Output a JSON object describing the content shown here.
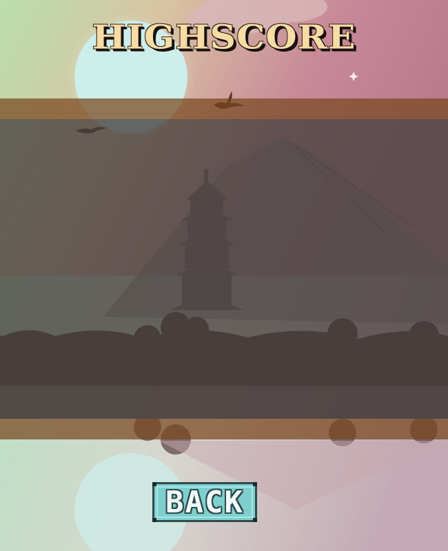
{
  "screen": {
    "title": "HIGHSCORE",
    "back_label": "BACK"
  },
  "colors": {
    "title_fill": "#f7dca6",
    "title_shadow": "#1a1110",
    "band": "#78461e",
    "panel": "#46403e",
    "button_fill": "#7fcfcf",
    "button_border": "#2f4b4d",
    "sky_top": "#c67e93",
    "sky_left": "#b8e0b0",
    "sun": "#cdeeea"
  },
  "icons": {
    "background": "pagoda-landscape-illustration",
    "sun": "sun-icon",
    "birds": "bird-icon"
  }
}
